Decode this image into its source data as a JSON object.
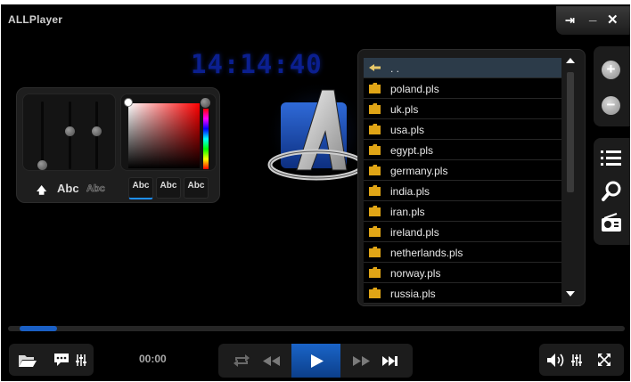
{
  "app": {
    "title": "ALLPlayer"
  },
  "window_controls": {
    "pin": "⇥",
    "minimize": "_",
    "close": "✕"
  },
  "clock": "14:14:40",
  "subtitle_panel": {
    "up_arrow": "🡅",
    "abc_large": "Abc",
    "abc_outline": "Abc",
    "style_buttons": [
      "Abc",
      "Abc",
      "Abc"
    ]
  },
  "playlist": {
    "items": [
      {
        "label": ". .",
        "icon": "arrow-back-icon",
        "selected": true
      },
      {
        "label": "poland.pls",
        "icon": "folder-icon"
      },
      {
        "label": "uk.pls",
        "icon": "folder-icon"
      },
      {
        "label": "usa.pls",
        "icon": "folder-icon"
      },
      {
        "label": "egypt.pls",
        "icon": "folder-icon"
      },
      {
        "label": "germany.pls",
        "icon": "folder-icon"
      },
      {
        "label": "india.pls",
        "icon": "folder-icon"
      },
      {
        "label": "iran.pls",
        "icon": "folder-icon"
      },
      {
        "label": "ireland.pls",
        "icon": "folder-icon"
      },
      {
        "label": "netherlands.pls",
        "icon": "folder-icon"
      },
      {
        "label": "norway.pls",
        "icon": "folder-icon"
      },
      {
        "label": "russia.pls",
        "icon": "folder-icon"
      }
    ]
  },
  "sidebar": {
    "zoom_in": "+",
    "zoom_out": "−",
    "icons": [
      "playlist-icon",
      "search-icon",
      "radio-icon"
    ]
  },
  "playback": {
    "time": "00:00",
    "progress_fraction": 0.06
  },
  "colors": {
    "accent": "#1a5fc4",
    "clock": "#0b1f8f",
    "selected_row": "#2c3b49",
    "folder": "#e0a516"
  }
}
